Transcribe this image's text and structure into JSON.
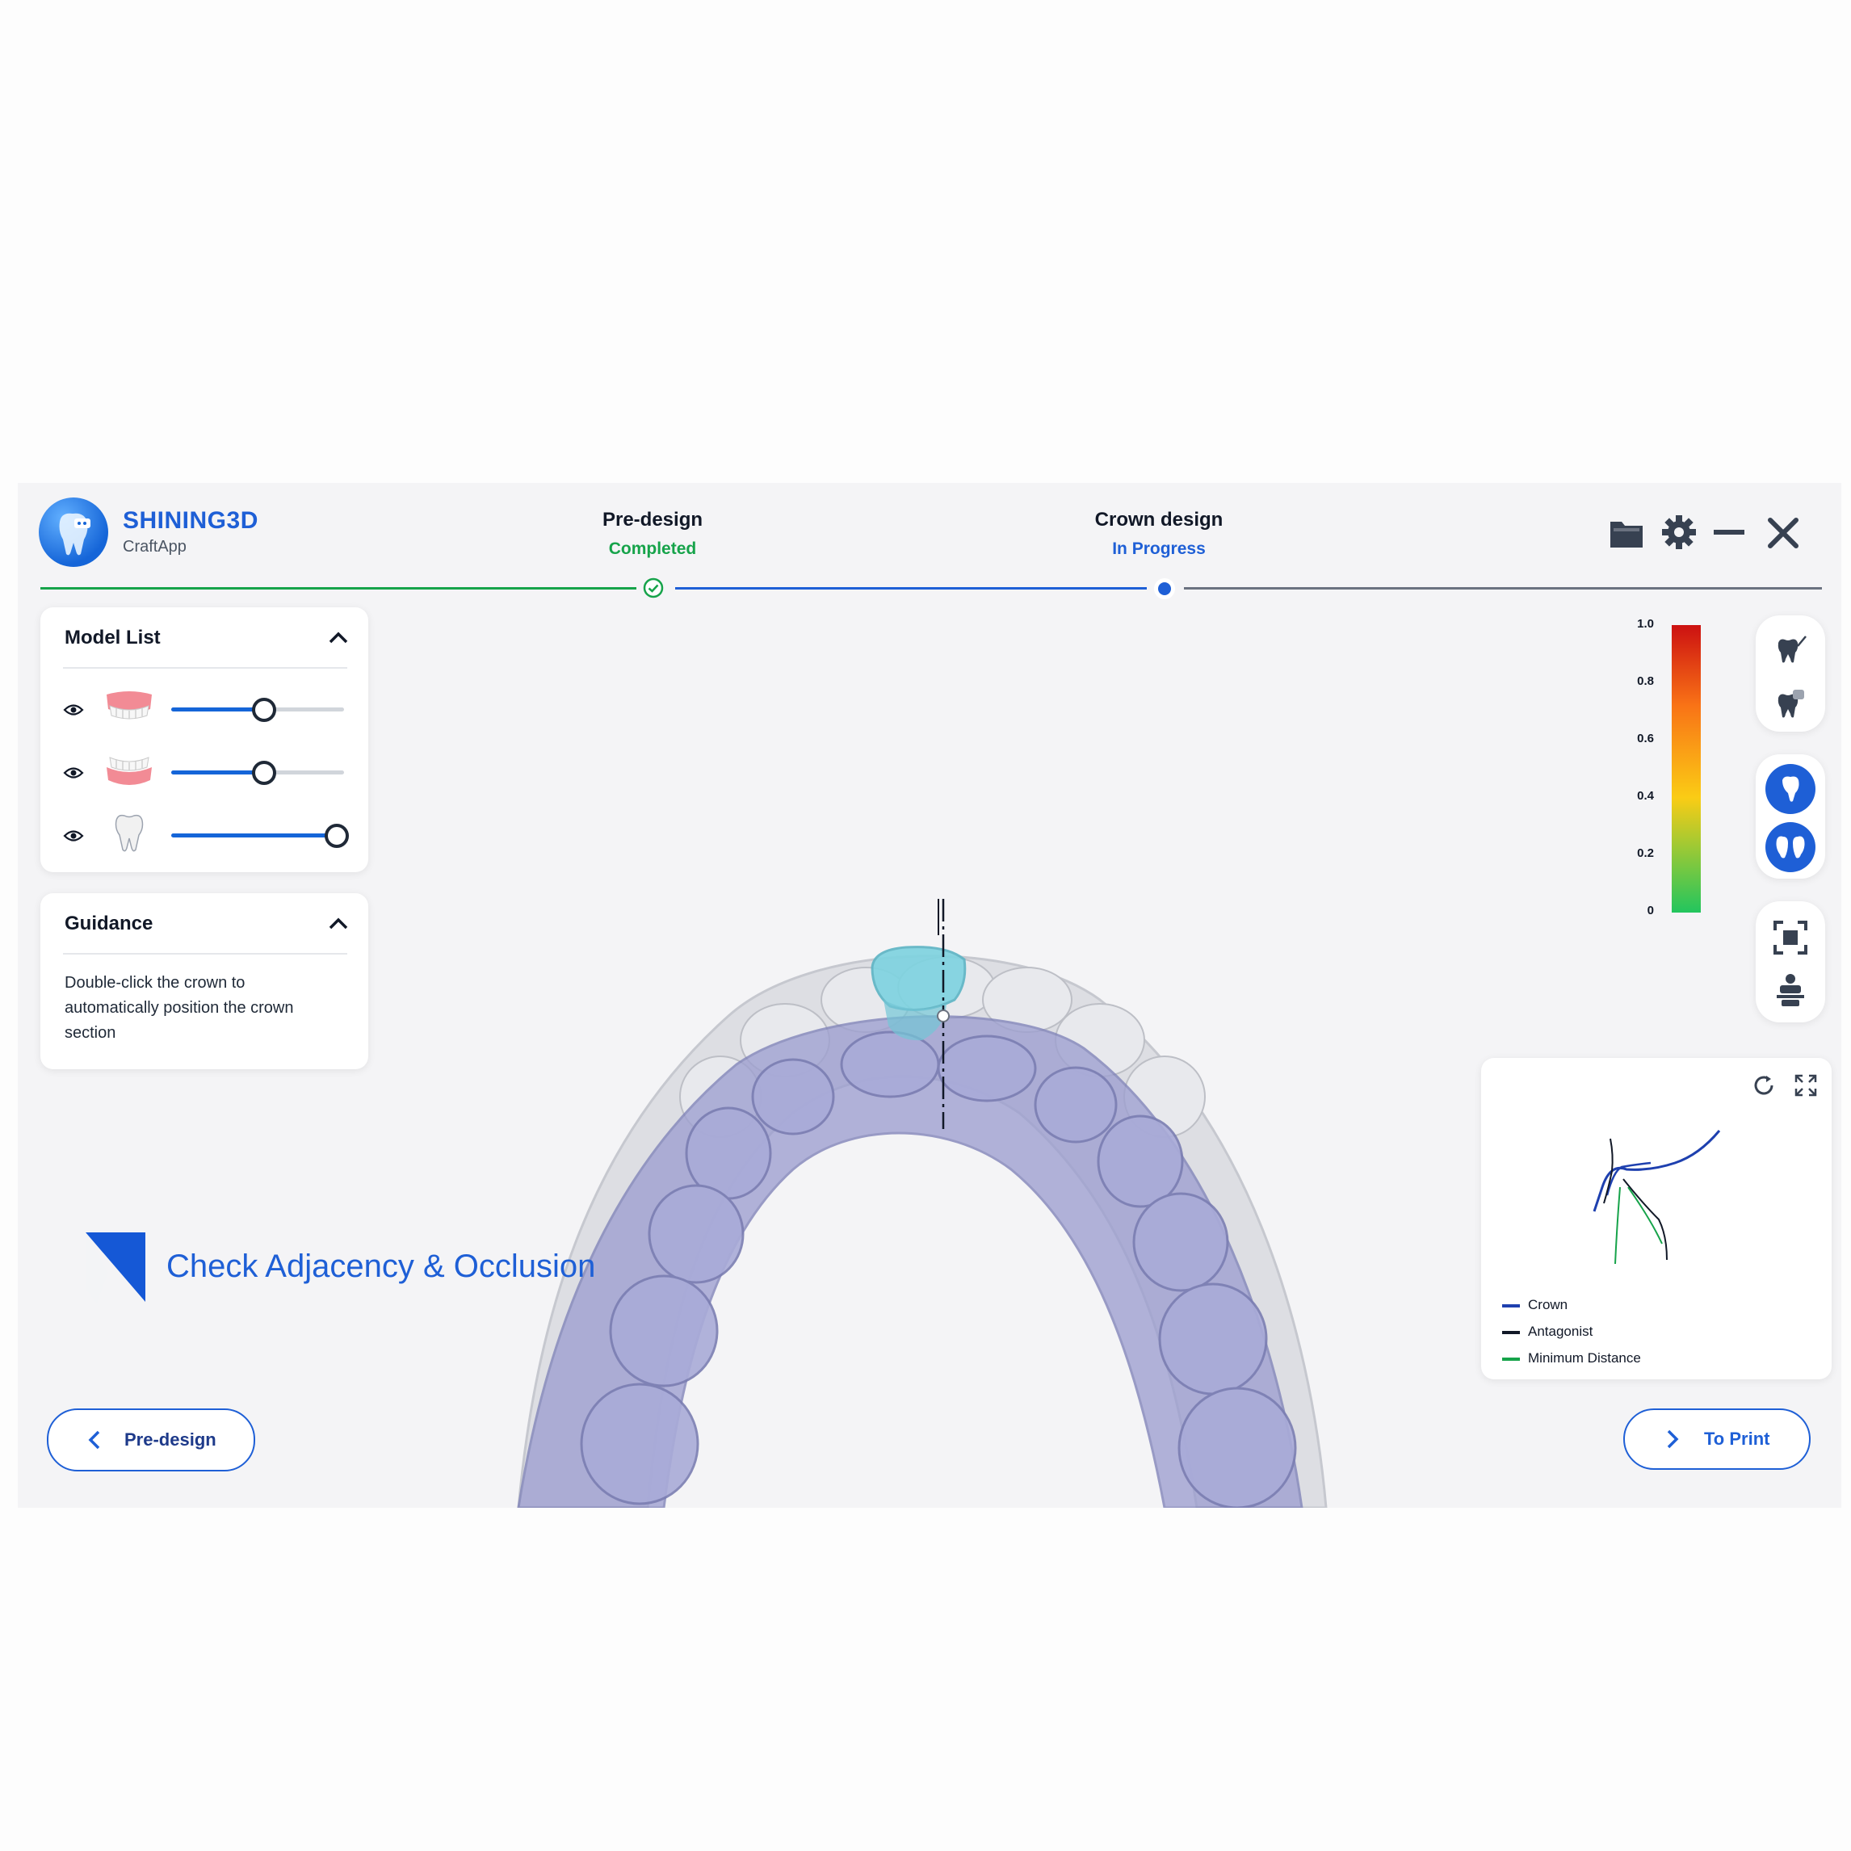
{
  "app": {
    "brand": "SHINING3D",
    "product": "CraftApp"
  },
  "steps": [
    {
      "title": "Pre-design",
      "status": "Completed",
      "status_color": "#16a34a"
    },
    {
      "title": "Crown design",
      "status": "In Progress",
      "status_color": "#1e5fd6"
    }
  ],
  "window_icons": [
    "folder-icon",
    "gear-icon",
    "minimize-icon",
    "close-icon"
  ],
  "model_list": {
    "title": "Model List",
    "items": [
      {
        "icon": "upper-jaw-icon",
        "opacity": 0.53
      },
      {
        "icon": "lower-jaw-icon",
        "opacity": 0.53
      },
      {
        "icon": "tooth-icon",
        "opacity": 0.95
      }
    ]
  },
  "guidance": {
    "title": "Guidance",
    "text": "Double-click the crown to automatically position the crown section"
  },
  "banner": {
    "text": "Check Adjacency & Occlusion"
  },
  "color_scale": {
    "ticks": [
      "1.0",
      "0.8",
      "0.6",
      "0.4",
      "0.2",
      "0"
    ]
  },
  "section_view": {
    "legend": [
      {
        "label": "Crown",
        "color": "#1e40af"
      },
      {
        "label": "Antagonist",
        "color": "#111827"
      },
      {
        "label": "Minimum Distance",
        "color": "#16a34a"
      }
    ]
  },
  "nav": {
    "back_label": "Pre-design",
    "next_label": "To Print"
  },
  "colors": {
    "accent": "#1e5fd6",
    "completed": "#16a34a"
  }
}
